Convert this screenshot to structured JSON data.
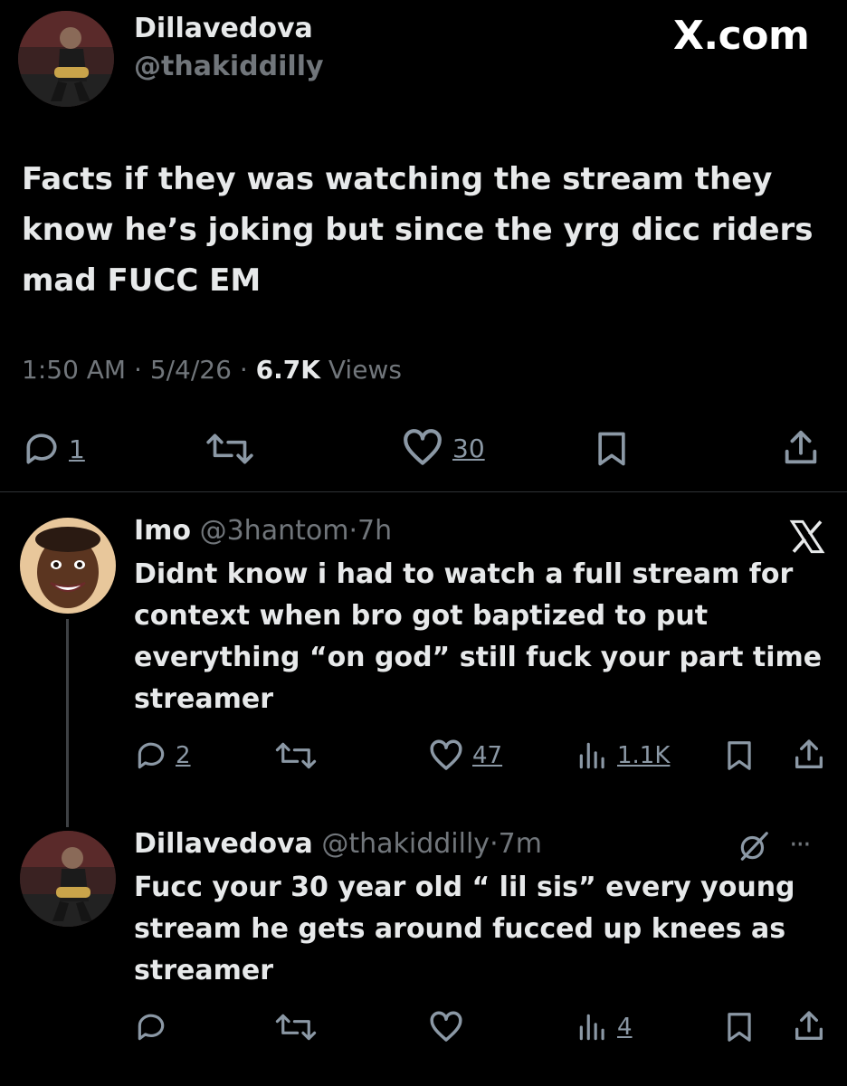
{
  "brand": {
    "watermark": "X.com"
  },
  "main_tweet": {
    "name": "Dillavedova",
    "handle": "@thakiddilly",
    "text": "Facts if they was watching the stream they know he’s joking but since the yrg dicc riders mad FUCC EM",
    "time": "1:50 AM",
    "date": "5/4/26",
    "views": "6.7K",
    "views_label": "Views",
    "sep": "·",
    "replies": "1",
    "likes": "30"
  },
  "reply1": {
    "name": "Imo",
    "handle": "@3hantom",
    "sep": "·",
    "age": "7h",
    "text": "Didnt know i had to watch a full stream  for context when bro got baptized to put everything “on god” still  fuck your part time streamer",
    "replies": "2",
    "likes": "47",
    "views": "1.1K"
  },
  "reply2": {
    "name": "Dillavedova",
    "handle": "@thakiddilly",
    "sep": "·",
    "age": "7m",
    "text": "Fucc your 30 year old “ lil sis” every young stream he gets around fucced up knees as streamer",
    "views": "4",
    "more": "···"
  },
  "colors": {
    "background": "#000000",
    "text": "#e7e9ea",
    "secondary": "#71767b",
    "icon": "#8b98a5",
    "divider": "#2f3336"
  }
}
